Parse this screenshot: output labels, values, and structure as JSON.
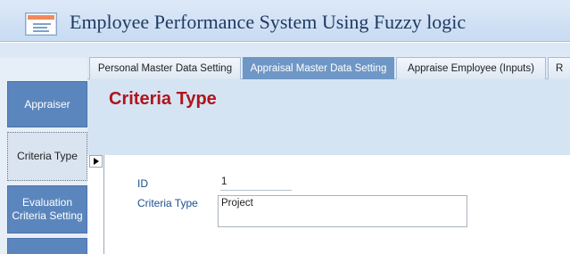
{
  "window": {
    "title": "Employee Performance System Using Fuzzy logic",
    "icon": "form-icon"
  },
  "tabs": [
    {
      "label": "Personal Master Data Setting",
      "active": false
    },
    {
      "label": "Appraisal Master Data Setting",
      "active": true
    },
    {
      "label": "Appraise Employee (Inputs)",
      "active": false
    },
    {
      "label": "R",
      "active": false
    }
  ],
  "nav": {
    "items": [
      {
        "label": "Appraiser",
        "selected": false
      },
      {
        "label": "Criteria Type",
        "selected": true
      },
      {
        "label_line1": "Evaluation",
        "label_line2": "Criteria Setting",
        "selected": false
      },
      {
        "label": "",
        "selected": false
      }
    ]
  },
  "form": {
    "title": "Criteria Type",
    "fields": {
      "id_label": "ID",
      "id_value": "1",
      "criteria_label": "Criteria Type",
      "criteria_value": "Project"
    }
  },
  "colors": {
    "accent": "#5b86bd",
    "active_tab": "#6f97c6",
    "form_title": "#b0141b",
    "header_bg": "#d5e4f3",
    "label": "#1a4f8c"
  }
}
